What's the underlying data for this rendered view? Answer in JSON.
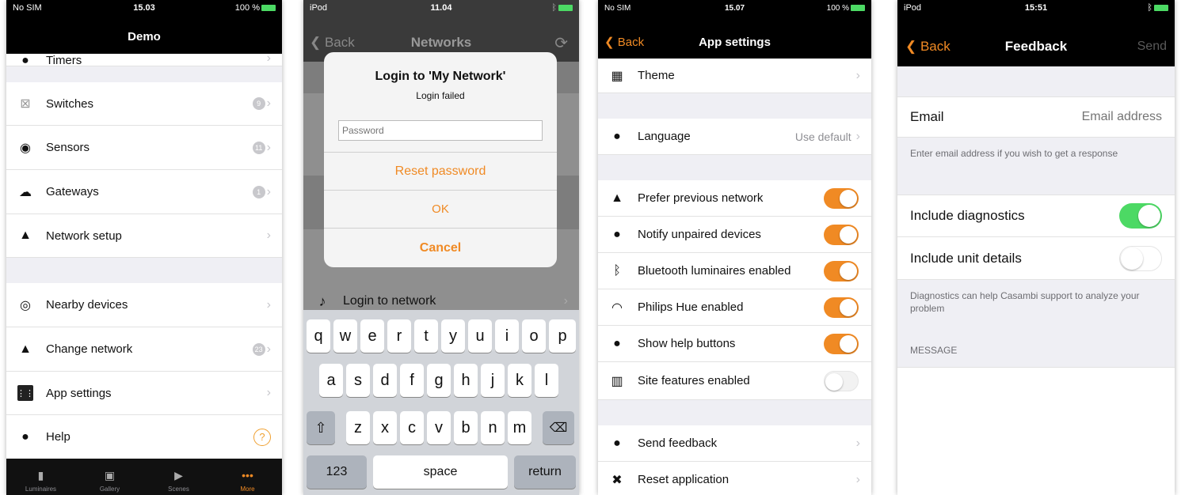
{
  "screen1": {
    "status": {
      "carrier": "No SIM",
      "time": "15.03",
      "battery": "100 %"
    },
    "title": "Demo",
    "items": [
      {
        "label": "Timers",
        "icon": "clock-icon",
        "badge": ""
      },
      {
        "label": "Switches",
        "icon": "switch-icon",
        "badge": "9"
      },
      {
        "label": "Sensors",
        "icon": "sensor-icon",
        "badge": "11"
      },
      {
        "label": "Gateways",
        "icon": "gateway-icon",
        "badge": "1"
      },
      {
        "label": "Network setup",
        "icon": "network-icon",
        "badge": ""
      },
      {
        "label": "Nearby devices",
        "icon": "nearby-icon",
        "badge": ""
      },
      {
        "label": "Change network",
        "icon": "network-icon",
        "badge": "23"
      },
      {
        "label": "App settings",
        "icon": "settings-icon",
        "badge": ""
      },
      {
        "label": "Help",
        "icon": "info-icon",
        "badge": ""
      }
    ],
    "tabs": [
      {
        "label": "Luminaires",
        "icon": "lamp-icon"
      },
      {
        "label": "Gallery",
        "icon": "gallery-icon"
      },
      {
        "label": "Scenes",
        "icon": "scenes-icon"
      },
      {
        "label": "More",
        "icon": "more-icon"
      }
    ]
  },
  "screen2": {
    "status": {
      "carrier": "iPod",
      "time": "11.04"
    },
    "back": "Back",
    "title": "Networks",
    "background_row": "Login to network",
    "dialog": {
      "title": "Login to 'My Network'",
      "message": "Login failed",
      "password_placeholder": "Password",
      "reset": "Reset password",
      "ok": "OK",
      "cancel": "Cancel"
    },
    "keyboard": {
      "row1": [
        "q",
        "w",
        "e",
        "r",
        "t",
        "y",
        "u",
        "i",
        "o",
        "p"
      ],
      "row2": [
        "a",
        "s",
        "d",
        "f",
        "g",
        "h",
        "j",
        "k",
        "l"
      ],
      "row3": [
        "z",
        "x",
        "c",
        "v",
        "b",
        "n",
        "m"
      ],
      "numbers": "123",
      "space": "space",
      "return": "return"
    }
  },
  "screen3": {
    "status": {
      "carrier": "No SIM",
      "time": "15.07",
      "battery": "100 %"
    },
    "back": "Back",
    "title": "App settings",
    "theme": "Theme",
    "language": "Language",
    "language_value": "Use default",
    "toggles": [
      {
        "label": "Prefer previous network",
        "on": true,
        "icon": "network-icon"
      },
      {
        "label": "Notify unpaired devices",
        "on": true,
        "icon": "chat-icon"
      },
      {
        "label": "Bluetooth luminaires enabled",
        "on": true,
        "icon": "bluetooth-icon"
      },
      {
        "label": "Philips Hue enabled",
        "on": true,
        "icon": "wifi-icon"
      },
      {
        "label": "Show help buttons",
        "on": true,
        "icon": "info-icon"
      },
      {
        "label": "Site features enabled",
        "on": false,
        "icon": "building-icon"
      }
    ],
    "send_feedback": "Send feedback",
    "reset_application": "Reset application",
    "accent": "#f08a24"
  },
  "screen4": {
    "status": {
      "carrier": "iPod",
      "time": "15:51"
    },
    "back": "Back",
    "title": "Feedback",
    "send": "Send",
    "email_label": "Email",
    "email_placeholder": "Email address",
    "email_hint": "Enter email address if you wish to get a response",
    "diagnostics": "Include diagnostics",
    "diagnostics_on": true,
    "unit_details": "Include unit details",
    "unit_details_on": false,
    "diagnostics_hint": "Diagnostics can help Casambi support to analyze your problem",
    "message_header": "MESSAGE",
    "accent": "#4cd964"
  }
}
